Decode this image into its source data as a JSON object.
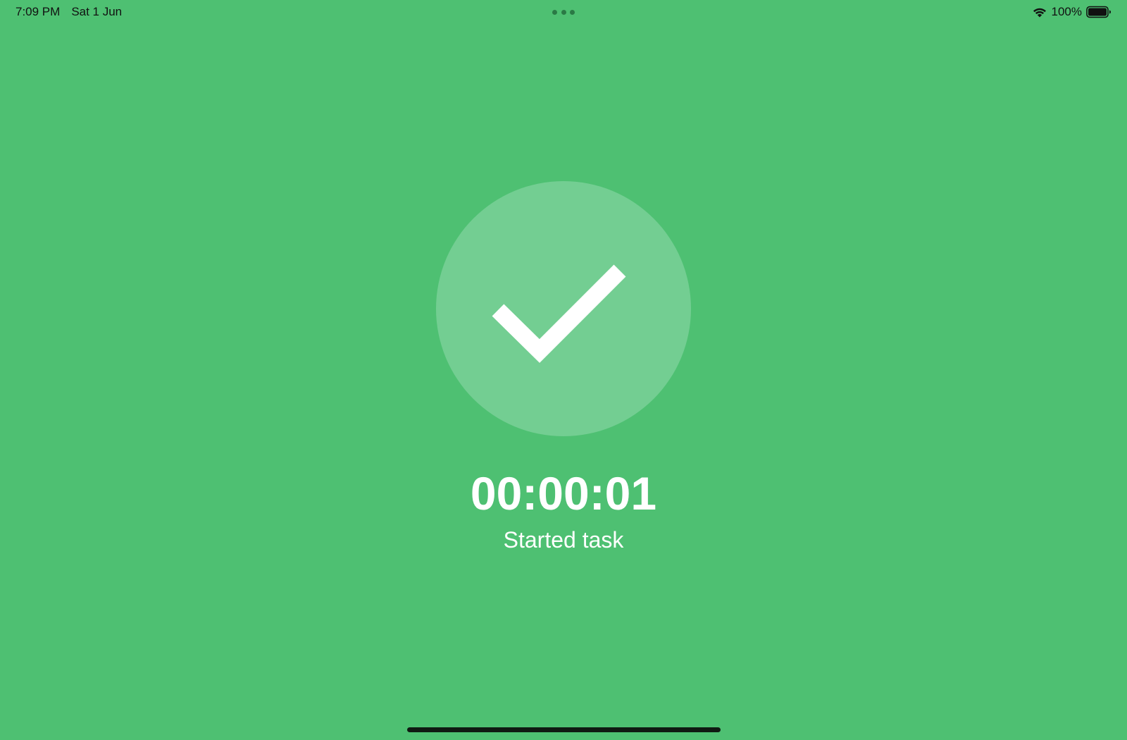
{
  "status_bar": {
    "time": "7:09 PM",
    "date": "Sat 1 Jun",
    "battery_percent": "100%",
    "battery_level": 1.0,
    "icons": [
      "wifi-icon",
      "battery-icon"
    ]
  },
  "main": {
    "timer": "00:00:01",
    "message": "Started task",
    "icon": "checkmark-icon"
  },
  "colors": {
    "background": "#4ec072",
    "circle": "#73ce92",
    "foreground": "#ffffff",
    "home_indicator": "#0f1a12"
  }
}
